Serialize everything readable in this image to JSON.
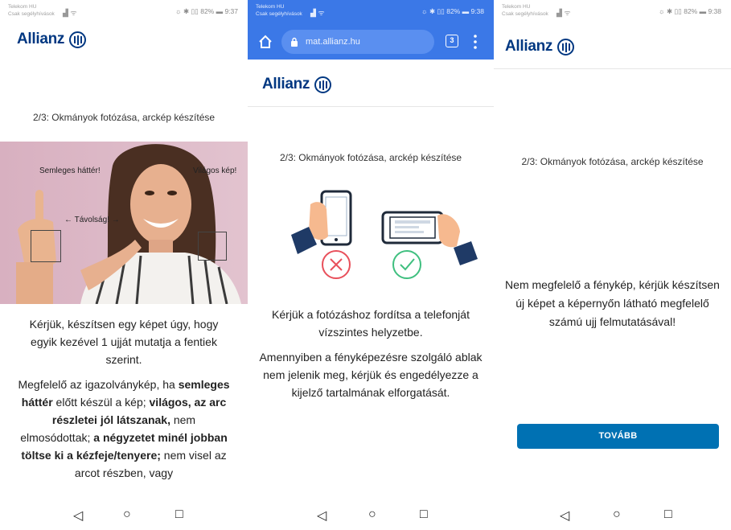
{
  "status_bar": {
    "operator_line1": "Telekom HU",
    "operator_line2": "Csak segélyhívások",
    "left_icons": "▟ ᯤ",
    "screen1_right": "☼ ✱ ▯▯ 82% ▬ 9:37",
    "screen2_right": "☼ ✱ ▯▯ 82% ▬ 9:38",
    "screen3_right": "☼ ✱ ▯▯ 82% ▬ 9:38",
    "battery_percent": 82
  },
  "brand": {
    "logo_text": "Allianz"
  },
  "browser": {
    "url": "mat.allianz.hu",
    "tab_count": "3"
  },
  "screen1": {
    "step_title": "2/3: Okmányok fotózása, arckép készítése",
    "photo_labels": {
      "left": "Semleges háttér!",
      "right": "Világos kép!",
      "distance": "← Távolság! →"
    },
    "instruction": "Kérjük, készítsen egy képet úgy, hogy egyik kezével 1 ujját mutatja a fentiek szerint.",
    "rules": {
      "p1_pre": "Megfelelő az igazolványkép, ha ",
      "p1_bold1": "semleges háttér",
      "p1_mid": " előtt készül a kép; ",
      "p1_bold2": "világos, az arc részletei jól látszanak,",
      "p1_mid2": " nem elmosódottak; ",
      "p1_bold3": "a négyzetet minél jobban töltse ki a kézfeje/tenyere;",
      "p1_end": " nem visel az arcot részben, vagy"
    }
  },
  "screen2": {
    "step_title": "2/3: Okmányok fotózása, arckép készítése",
    "instruction1": "Kérjük a fotózáshoz fordítsa a telefonját vízszintes helyzetbe.",
    "instruction2": "Amennyiben a fényképezésre szolgáló ablak nem jelenik meg, kérjük és engedélyezze a kijelző tartalmának elforgatását.",
    "colors": {
      "wrong": "#e8505b",
      "right": "#3fbf7f",
      "sleeve": "#1f3a66",
      "skin": "#f6b98f"
    }
  },
  "screen3": {
    "step_title": "2/3: Okmányok fotózása, arckép készítése",
    "message": "Nem megfelelő a fénykép, kérjük készítsen új képet a képernyőn látható megfelelő számú ujj felmutatásával!",
    "button_label": "TOVÁBB",
    "button_color": "#0071b3"
  },
  "nav_bar": {
    "back": "◁",
    "home": "○",
    "recents": "□"
  }
}
